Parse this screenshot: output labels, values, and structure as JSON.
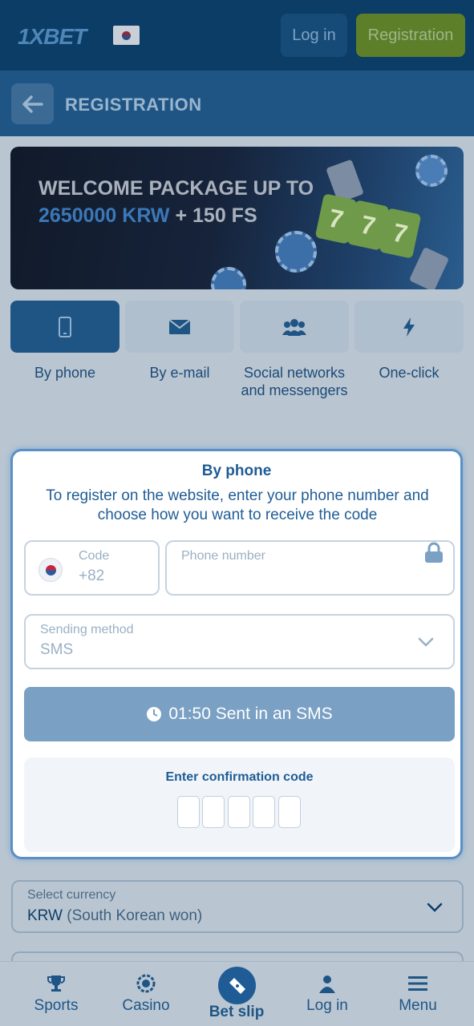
{
  "header": {
    "logo": "1XBET",
    "login_label": "Log in",
    "registration_label": "Registration"
  },
  "subheader": {
    "title": "REGISTRATION",
    "back_icon": "arrow-left-icon"
  },
  "banner": {
    "line1": "WELCOME PACKAGE UP TO",
    "amount": "2650000 KRW",
    "bonus": " + 150 FS",
    "reel_symbol": "7"
  },
  "methods": [
    {
      "label": "By phone",
      "icon": "phone-icon",
      "active": true
    },
    {
      "label": "By e-mail",
      "icon": "envelope-icon",
      "active": false
    },
    {
      "label": "Social networks and messengers",
      "icon": "people-icon",
      "active": false
    },
    {
      "label": "One-click",
      "icon": "lightning-icon",
      "active": false
    }
  ],
  "form": {
    "title": "By phone",
    "description": "To register on the website, enter your phone number and choose how you want to receive the code",
    "code_label": "Code",
    "code_value": "+82",
    "phone_placeholder": "Phone number",
    "sending_label": "Sending method",
    "sending_value": "SMS",
    "send_button": "01:50 Sent in an SMS",
    "confirm_title": "Enter confirmation code",
    "code_cells": 5
  },
  "currency": {
    "label": "Select currency",
    "code": "KRW",
    "name": "(South Korean won)"
  },
  "bottom_nav": {
    "sports": "Sports",
    "casino": "Casino",
    "betslip": "Bet slip",
    "login": "Log in",
    "menu": "Menu"
  },
  "colors": {
    "primary": "#1f5585",
    "header": "#0b3d66",
    "accent_green": "#5d7f2a",
    "card_border": "#5a8fc7"
  }
}
